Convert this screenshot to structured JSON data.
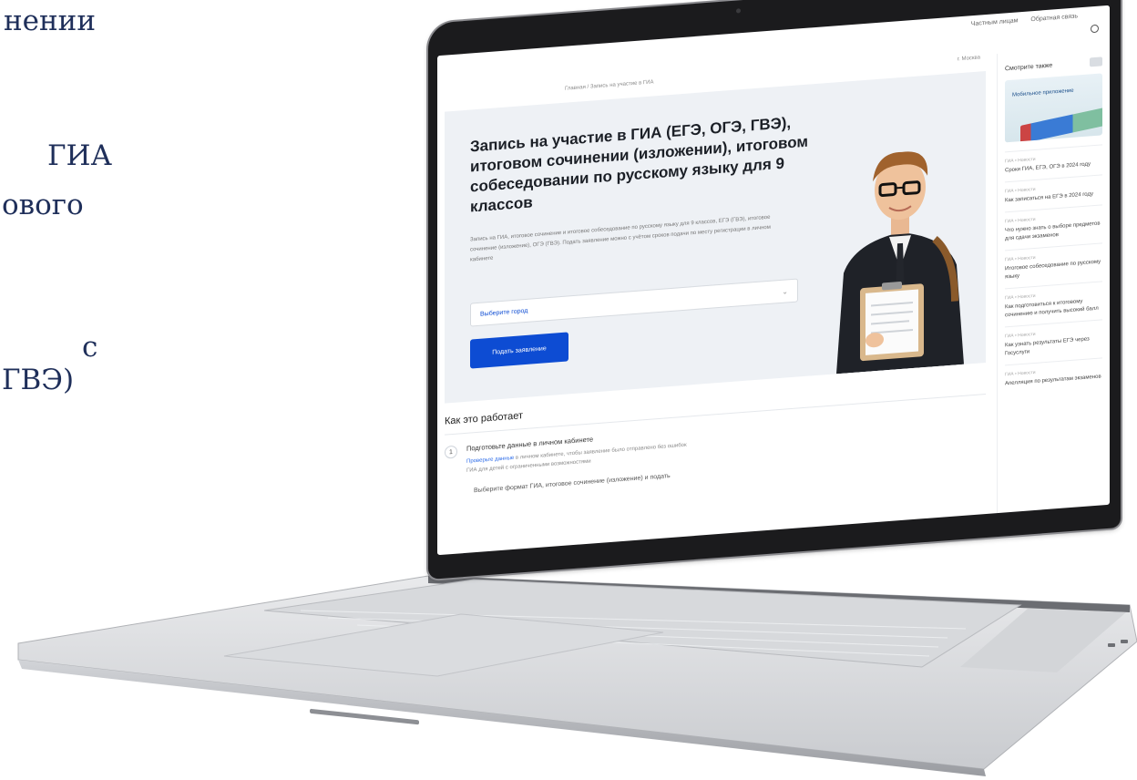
{
  "slide_fragments": [
    "нении",
    "ГИА",
    "ового",
    "с",
    "ГВЭ)"
  ],
  "screen": {
    "topbar": {
      "link1": "Частным лицам",
      "link2": "Обратная связь"
    },
    "breadcrumb": {
      "path": "Главная / Запись на участие в ГИА",
      "location": "г. Москва"
    },
    "hero": {
      "title": "Запись на участие в ГИА (ЕГЭ, ОГЭ, ГВЭ), итоговом сочинении (изложении), итоговом собеседовании по русскому языку для 9 классов",
      "description": "Запись на ГИА, итоговое сочинение и итоговое собеседование по русскому языку для 9 классов, ЕГЭ (ГВЭ), итоговое сочинение (изложение), ОГЭ (ГВЭ). Подать заявление можно с учётом сроков подачи по месту регистрации в личном кабинете",
      "select_placeholder": "Выберите город",
      "submit_label": "Подать заявление"
    },
    "how": {
      "title": "Как это работает",
      "step1_number": "1",
      "step1_title": "Подготовьте данные в личном кабинете",
      "step1_link": "Проверьте данные",
      "step1_text": "в личном кабинете, чтобы заявление было отправлено без ошибок",
      "step1_text2": "ГИА для детей с ограниченными возможностями",
      "step2_title": "Выберите формат ГИА, итоговое сочинение (изложение) и подать"
    },
    "sidebar": {
      "header": "Смотрите также",
      "promo": "Мобильное приложение",
      "news": [
        {
          "tag": "ГИА • Новости",
          "title": "Сроки ГИА, ЕГЭ, ОГЭ в 2024 году"
        },
        {
          "tag": "ГИА • Новости",
          "title": "Как записаться на ЕГЭ в 2024 году"
        },
        {
          "tag": "ГИА • Новости",
          "title": "Что нужно знать о выборе предметов для сдачи экзаменов"
        },
        {
          "tag": "ГИА • Новости",
          "title": "Итоговое собеседование по русскому языку"
        },
        {
          "tag": "ГИА • Новости",
          "title": "Как подготовиться к итоговому сочинению и получить высокий балл"
        },
        {
          "tag": "ГИА • Новости",
          "title": "Как узнать результаты ЕГЭ через Госуслуги"
        },
        {
          "tag": "ГИА • Новости",
          "title": "Апелляция по результатам экзаменов"
        }
      ]
    }
  }
}
